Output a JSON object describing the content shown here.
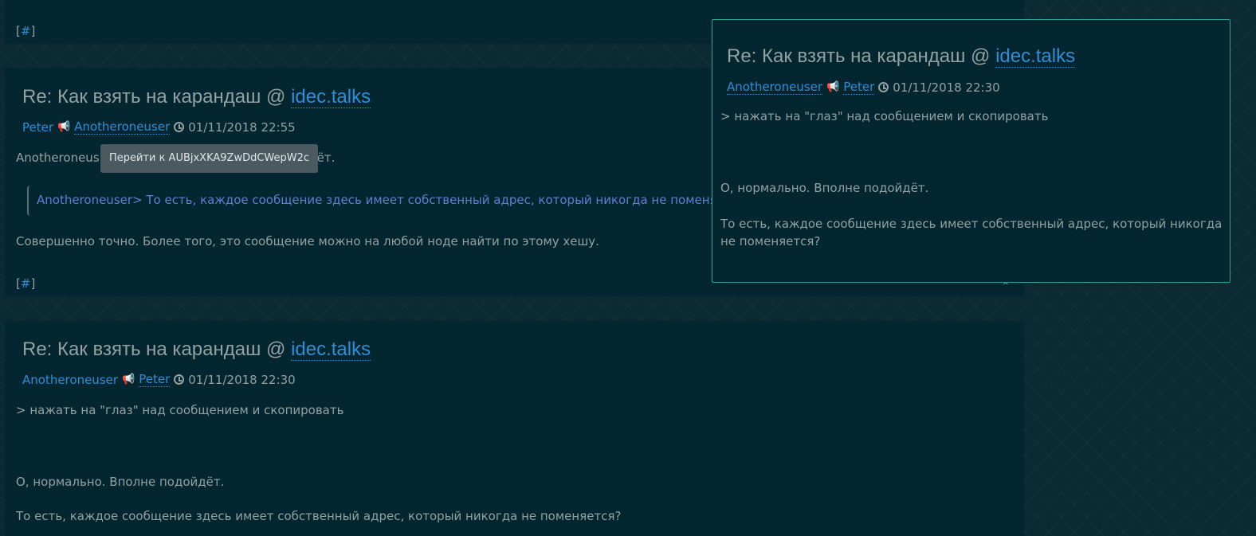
{
  "top_post": {
    "hash_label": "#"
  },
  "post1": {
    "title_prefix": "Re: Как взять на карандаш @ ",
    "echo": "idec.talks",
    "from": "Peter",
    "to": "Anotheroneuser",
    "date": "01/11/2018 22:55",
    "line1_start": "Anotheroneus",
    "line1_end": "ёт.",
    "quote": "Anotheroneuser> То есть, каждое сообщение здесь имеет собственный адрес, который никогда не поменя",
    "line2": "Совершенно точно. Более того, это сообщение можно на любой ноде найти по этому хешу.",
    "hash_label": "#"
  },
  "tooltip": {
    "text": "Перейти к AUBjxXKA9ZwDdCWepW2c"
  },
  "post2": {
    "title_prefix": "Re: Как взять на карандаш @ ",
    "echo": "idec.talks",
    "from": "Anotheroneuser",
    "to": "Peter",
    "date": "01/11/2018 22:30",
    "line1": "> нажать на \"глаз\" над сообщением и скопировать",
    "line2": "О, нормально. Вполне подойдёт.",
    "line3": "То есть, каждое сообщение здесь имеет собственный адрес, который никогда не поменяется?"
  },
  "popup": {
    "title_prefix": "Re: Как взять на карандаш @ ",
    "echo": "idec.talks",
    "from": "Anotheroneuser",
    "to": "Peter",
    "date": "01/11/2018 22:30",
    "line1": "> нажать на \"глаз\" над сообщением и скопировать",
    "line2": "О, нормально. Вполне подойдёт.",
    "line3a": "То есть, каждое сообщение здесь имеет собственный адрес, который никогда",
    "line3b": "не поменяется?"
  },
  "icons": {
    "megaphone": "megaphone-icon",
    "clock": "clock-icon",
    "star": "star-icon"
  }
}
